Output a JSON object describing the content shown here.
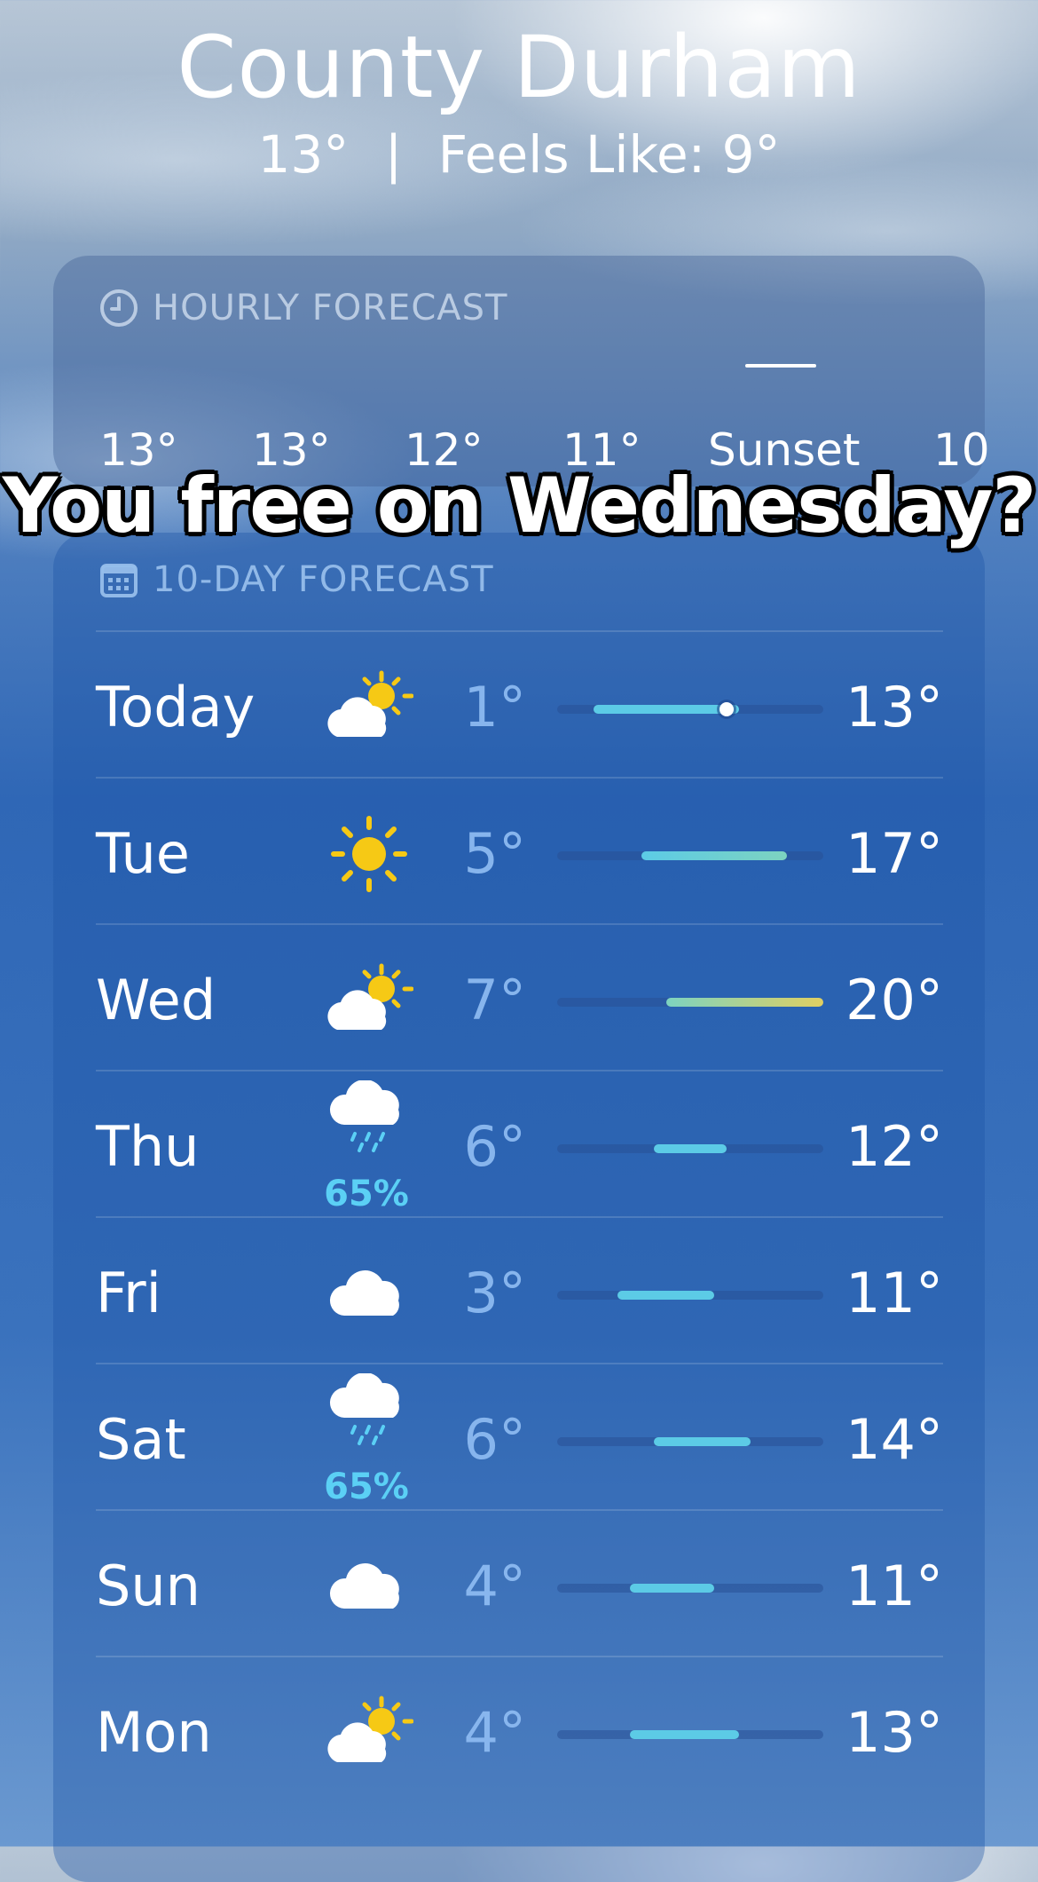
{
  "location": "County Durham",
  "current": {
    "temp": "13°",
    "separator": "|",
    "feels_like": "Feels Like: 9°"
  },
  "hourly": {
    "header": "HOURLY FORECAST",
    "items": [
      "13°",
      "13°",
      "12°",
      "11°",
      "Sunset",
      "10"
    ]
  },
  "caption": "You free on Wednesday?",
  "tenday": {
    "header": "10-DAY FORECAST",
    "days": [
      {
        "day": "Today",
        "icon": "partly-cloudy-sun-icon",
        "precip": "",
        "low": "1°",
        "high": "13°",
        "range": [
          1,
          13
        ],
        "current": 12
      },
      {
        "day": "Tue",
        "icon": "sun-icon",
        "precip": "",
        "low": "5°",
        "high": "17°",
        "range": [
          5,
          17
        ]
      },
      {
        "day": "Wed",
        "icon": "partly-cloudy-sun-icon",
        "precip": "",
        "low": "7°",
        "high": "20°",
        "range": [
          7,
          20
        ]
      },
      {
        "day": "Thu",
        "icon": "rain-cloud-icon",
        "precip": "65%",
        "low": "6°",
        "high": "12°",
        "range": [
          6,
          12
        ]
      },
      {
        "day": "Fri",
        "icon": "cloud-icon",
        "precip": "",
        "low": "3°",
        "high": "11°",
        "range": [
          3,
          11
        ]
      },
      {
        "day": "Sat",
        "icon": "rain-cloud-icon",
        "precip": "65%",
        "low": "6°",
        "high": "14°",
        "range": [
          6,
          14
        ]
      },
      {
        "day": "Sun",
        "icon": "cloud-icon",
        "precip": "",
        "low": "4°",
        "high": "11°",
        "range": [
          4,
          11
        ]
      },
      {
        "day": "Mon",
        "icon": "partly-cloudy-sun-icon",
        "precip": "",
        "low": "4°",
        "high": "13°",
        "range": [
          4,
          13
        ]
      }
    ],
    "scale": [
      -2,
      20
    ]
  },
  "colors": {
    "cool": "#5ccbe6",
    "mild": "#7dd3c0",
    "warm": "#e0cf62"
  }
}
